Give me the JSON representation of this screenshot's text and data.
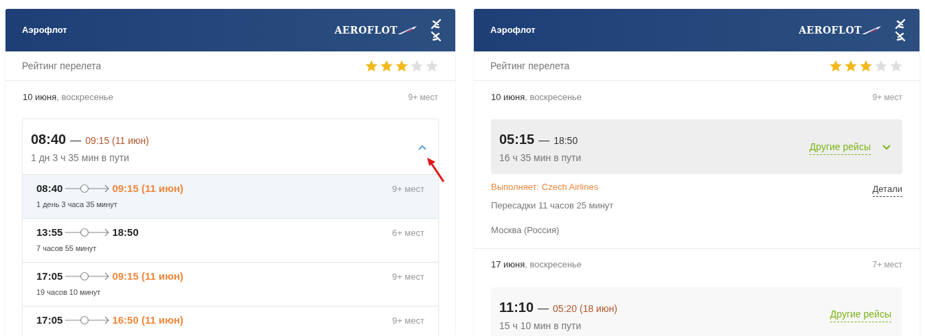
{
  "cards": [
    {
      "airline": "Аэрофлот",
      "logo": "AEROFLOT",
      "rating_label": "Рейтинг перелета",
      "stars": 3,
      "days": [
        {
          "date_bold": "10 июня",
          "date_rest": ", воскресенье",
          "seats": "9+ мест",
          "flight": {
            "depart": "08:40",
            "arrive": "09:15 (11 июн)",
            "next_day": true,
            "duration": "1 дн 3 ч 35 мин в пути",
            "dash": "—",
            "expanded": true,
            "shaded": false,
            "options": [
              {
                "depart": "08:40",
                "arrive": "09:15 (11 июн)",
                "next_day": true,
                "seats": "9+ мест",
                "duration": "1 день 3 часа 35 минут",
                "selected": true
              },
              {
                "depart": "13:55",
                "arrive": "18:50",
                "next_day": false,
                "seats": "6+ мест",
                "duration": "7 часов 55 минут",
                "selected": false
              },
              {
                "depart": "17:05",
                "arrive": "09:15 (11 июн)",
                "next_day": true,
                "seats": "9+ мест",
                "duration": "19 часов 10 минут",
                "selected": false
              },
              {
                "depart": "17:05",
                "arrive": "16:50 (11 июн)",
                "next_day": true,
                "seats": "9+ мест",
                "selected": false
              }
            ]
          }
        }
      ]
    },
    {
      "airline": "Аэрофлот",
      "logo": "AEROFLOT",
      "rating_label": "Рейтинг перелета",
      "stars": 3,
      "days": [
        {
          "date_bold": "10 июня",
          "date_rest": ", воскресенье",
          "seats": "9+ мест",
          "flight": {
            "depart": "05:15",
            "arrive": "18:50",
            "next_day": false,
            "duration": "16 ч 35 мин в пути",
            "dash": "—",
            "expanded": false,
            "other": "Другие рейсы",
            "shaded": true
          },
          "operator": "Выполняет: Czech Airlines",
          "details": "Детали",
          "transfer": "Пересадки 11 часов 25 минут",
          "city": "Москва (Россия)"
        },
        {
          "date_bold": "17 июня",
          "date_rest": ", воскресенье",
          "seats": "7+ мест",
          "flight": {
            "depart": "11:10",
            "arrive": "05:20 (18 июн)",
            "next_day": true,
            "duration": "15 ч 10 мин в пути",
            "dash": "—",
            "expanded": false,
            "other": "Другие рейсы",
            "shaded": false
          }
        }
      ]
    }
  ]
}
